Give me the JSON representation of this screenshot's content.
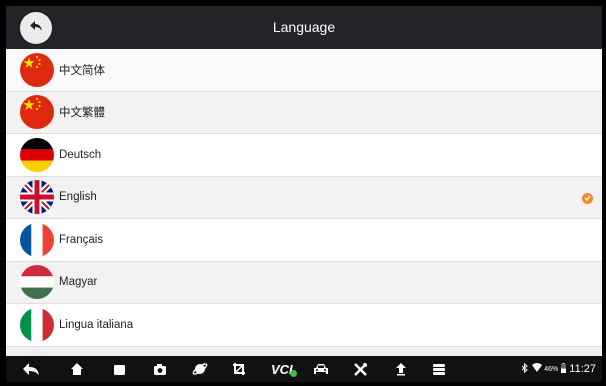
{
  "header": {
    "title": "Language",
    "back_icon": "back-arrow-icon"
  },
  "languages": [
    {
      "label": "中文简体",
      "flag": "china",
      "selected": false
    },
    {
      "label": "中文繁體",
      "flag": "china",
      "selected": false
    },
    {
      "label": "Deutsch",
      "flag": "germany",
      "selected": false
    },
    {
      "label": "English",
      "flag": "uk",
      "selected": true
    },
    {
      "label": "Français",
      "flag": "france",
      "selected": false
    },
    {
      "label": "Magyar",
      "flag": "hungary",
      "selected": false
    },
    {
      "label": "Lingua italiana",
      "flag": "italy",
      "selected": false
    }
  ],
  "colors": {
    "header_bg": "#222428",
    "selected_check": "#f08a2a",
    "navbar_bg": "#111111"
  },
  "navbar": {
    "icons": [
      "back-icon",
      "home-icon",
      "recent-apps-icon",
      "camera-icon",
      "browser-icon",
      "crop-icon",
      "vci-icon",
      "car-icon",
      "tools-icon",
      "upload-icon",
      "menu-icon"
    ],
    "vci_label": "VCI",
    "status": {
      "battery_percent": "46%",
      "time": "11:27",
      "icons": [
        "bluetooth-icon",
        "wifi-icon",
        "battery-icon"
      ]
    }
  }
}
